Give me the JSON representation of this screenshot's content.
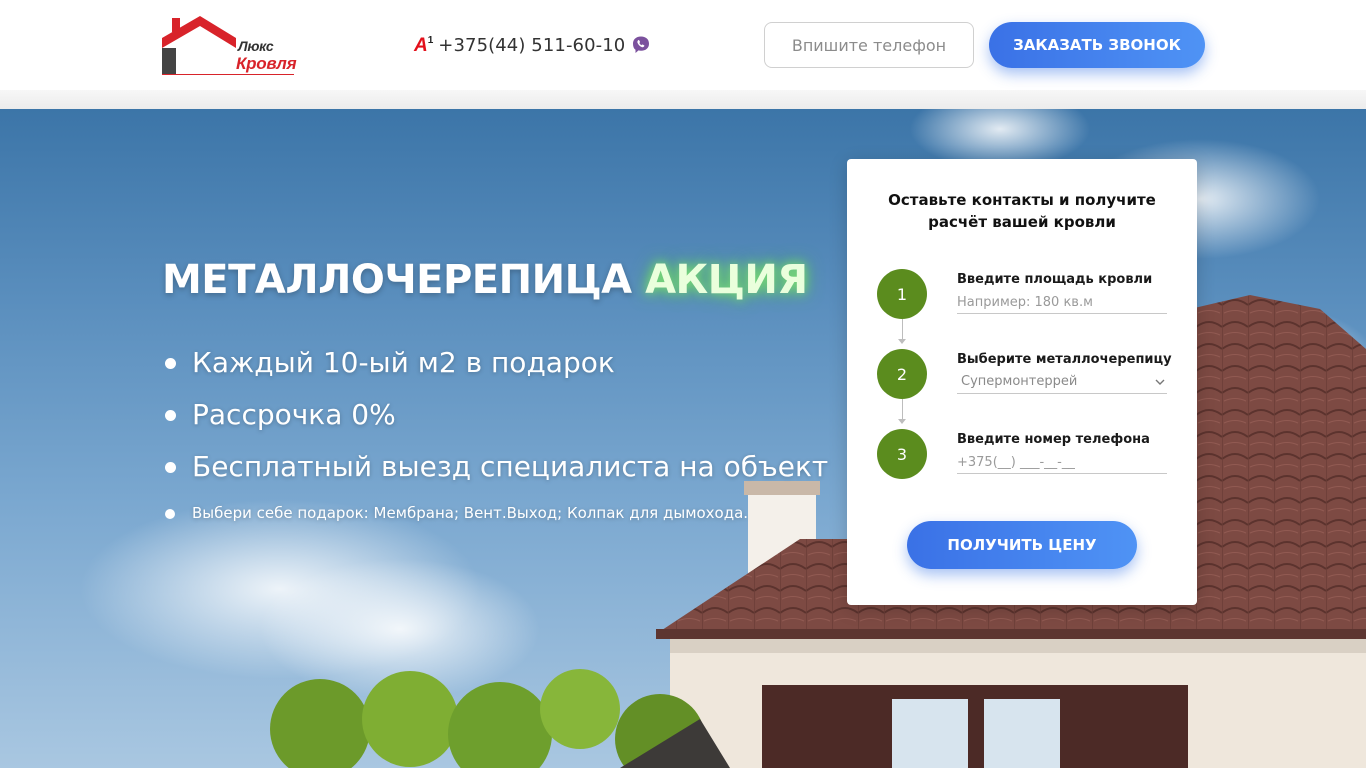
{
  "header": {
    "logo": {
      "word1": "Люкс",
      "word2": "Кровля"
    },
    "phone": {
      "operator_icon": "a1-operator-icon",
      "operator_mark": "A",
      "operator_sup": "1",
      "number": "+375(44) 511-60-10",
      "messenger_icon": "viber-icon"
    },
    "phone_input": {
      "placeholder": "Впишите телефон",
      "value": ""
    },
    "callback_button": {
      "label": "ЗАКАЗАТЬ ЗВОНОК"
    }
  },
  "hero": {
    "title_main": "МЕТАЛЛОЧЕРЕПИЦА ",
    "title_accent": "АКЦИЯ",
    "benefits": [
      "Каждый 10-ый м2 в подарок",
      "Рассрочка 0%",
      "Бесплатный выезд специалиста на объект"
    ],
    "gift_note": "Выбери себе подарок: Мембрана; Вент.Выход; Колпак для дымохода."
  },
  "form": {
    "title": "Оставьте контакты и получите расчёт вашей кровли",
    "steps": [
      {
        "number": "1",
        "label": "Введите площадь кровли",
        "placeholder": "Например: 180 кв.м"
      },
      {
        "number": "2",
        "label": "Выберите металлочерепицу",
        "selected": "Супермонтеррей"
      },
      {
        "number": "3",
        "label": "Введите номер телефона",
        "placeholder": "+375(__) ___-__-__"
      }
    ],
    "submit_label": "ПОЛУЧИТЬ ЦЕНУ"
  },
  "colors": {
    "brand_red": "#d8232a",
    "accent_blue": "#3a71e6",
    "step_green": "#5b8c1e"
  }
}
